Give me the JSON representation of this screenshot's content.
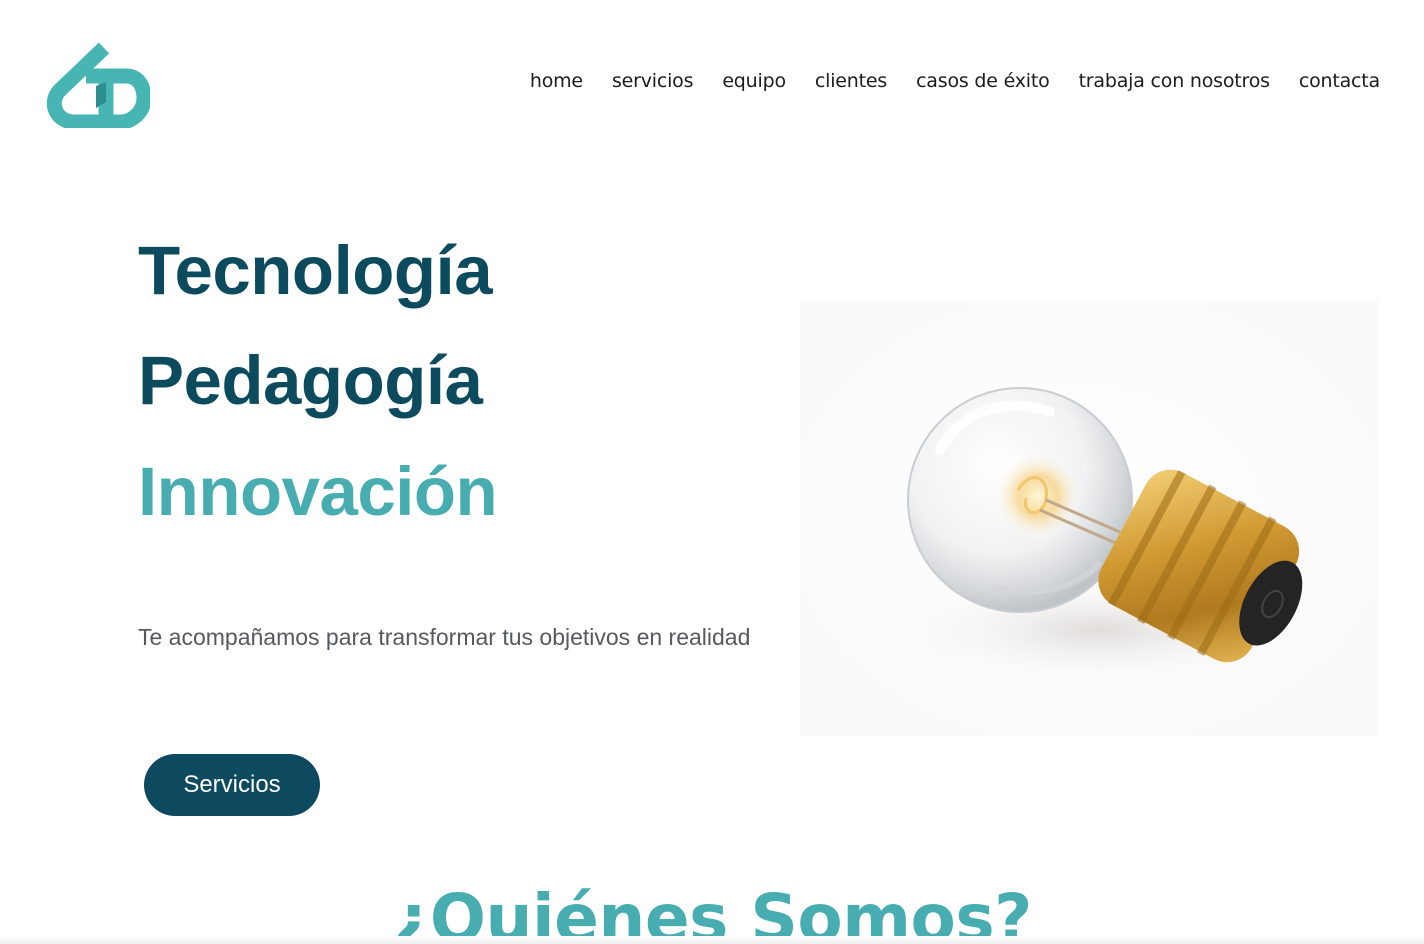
{
  "nav": {
    "items": [
      {
        "label": "home"
      },
      {
        "label": "servicios"
      },
      {
        "label": "equipo"
      },
      {
        "label": "clientes"
      },
      {
        "label": "casos de éxito"
      },
      {
        "label": "trabaja con nosotros"
      },
      {
        "label": "contacta"
      }
    ]
  },
  "hero": {
    "lines": [
      "Tecnología",
      "Pedagogía",
      "Innovación"
    ],
    "subtitle": "Te acompañamos para transformar tus objetivos en realidad",
    "cta_label": "Servicios",
    "image_icon": "light-bulb-image"
  },
  "about": {
    "title": "¿Quiénes Somos?"
  },
  "logo": {
    "icon": "brand-logo-icon"
  },
  "colors": {
    "primary": "#0c4a5e",
    "accent": "#47adb0",
    "text": "#555a5e"
  }
}
